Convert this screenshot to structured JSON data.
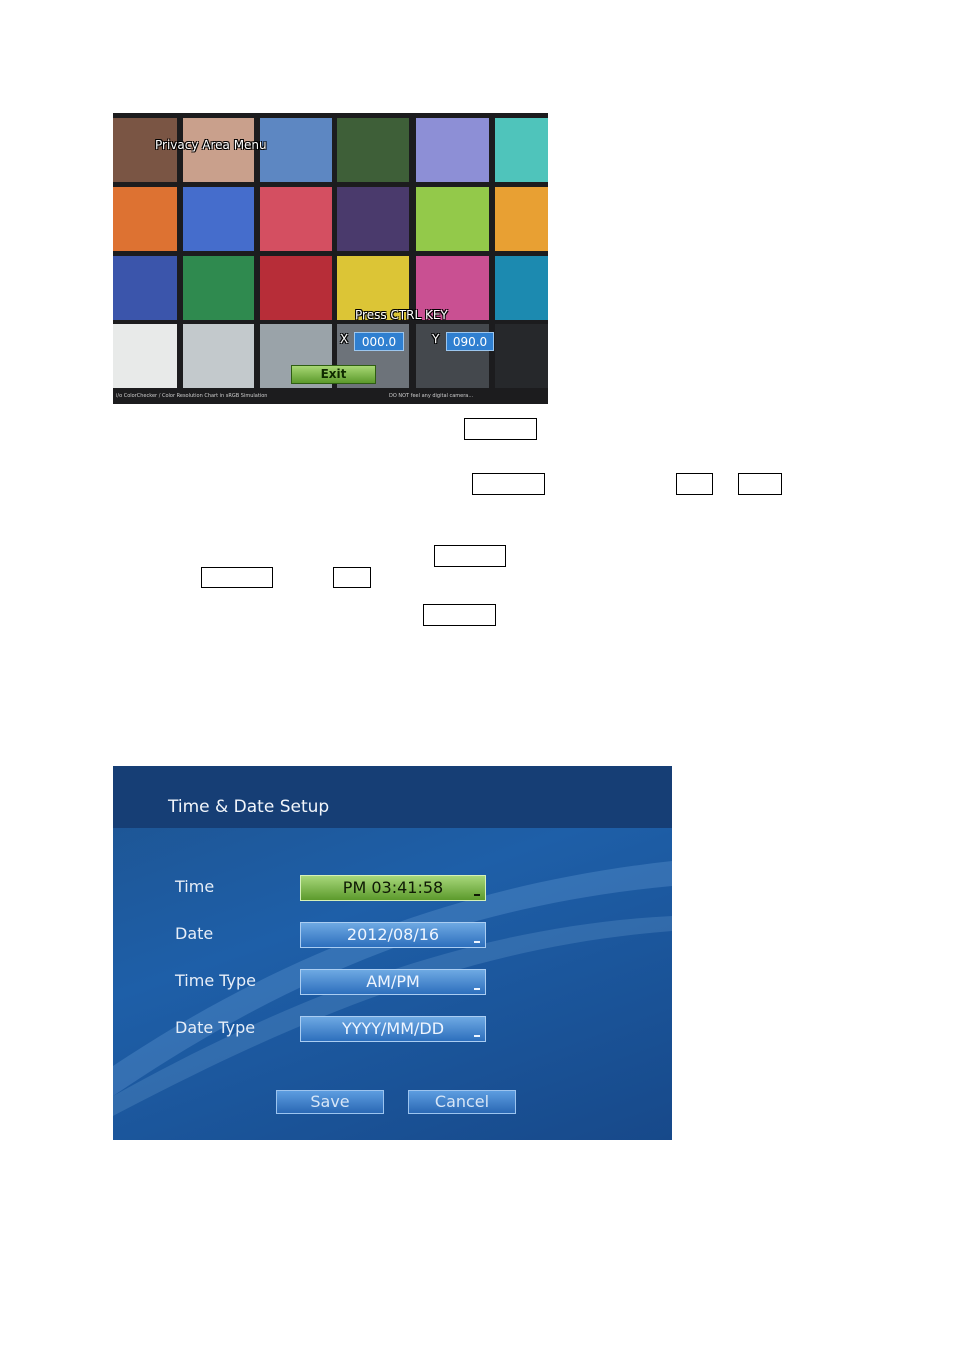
{
  "privacy_menu": {
    "title": "Privacy  Area  Menu",
    "prompt": "Press  CTRL  KEY",
    "x_label": "X",
    "x_value": "000.0",
    "y_label": "Y",
    "y_value": "090.0",
    "exit_label": "Exit",
    "footer_left": "i/o ColorChecker / Color Resolution Chart in sRGB Simulation",
    "footer_right": "DO NOT feel any digital camera...",
    "patch_colors": [
      "#7a5544",
      "#c9a08c",
      "#5d87c2",
      "#3e5f38",
      "#8d8fd6",
      "#4fc4bb",
      "#dd7232",
      "#456dcc",
      "#d44f61",
      "#4a3a6c",
      "#93c94a",
      "#e8a033",
      "#3b55ab",
      "#2f8a4f",
      "#b72d38",
      "#dcc536",
      "#c95092",
      "#1c8ab0",
      "#e8eae9",
      "#c3c9cc",
      "#9aa3a9",
      "#6d737a",
      "#44484d",
      "#26282b"
    ]
  },
  "time_date_setup": {
    "title": "Time & Date Setup",
    "rows": [
      {
        "label": "Time",
        "value": "PM 03:41:58"
      },
      {
        "label": "Date",
        "value": "2012/08/16"
      },
      {
        "label": "Time Type",
        "value": "AM/PM"
      },
      {
        "label": "Date Type",
        "value": "YYYY/MM/DD"
      }
    ],
    "save_label": "Save",
    "cancel_label": "Cancel"
  }
}
